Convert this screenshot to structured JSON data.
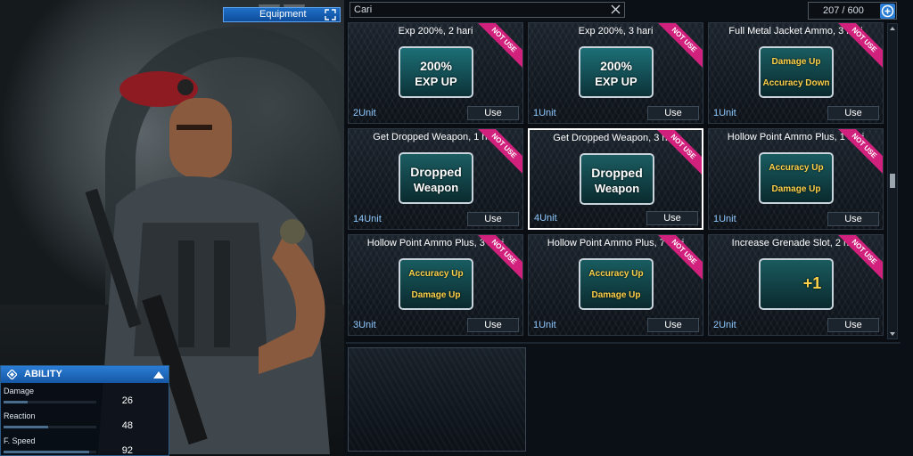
{
  "equipment": {
    "label": "Equipment"
  },
  "ability": {
    "title": "ABILITY",
    "stats": [
      {
        "label": "Damage",
        "value": "26",
        "fraction": 0.26
      },
      {
        "label": "Reaction",
        "value": "48",
        "fraction": 0.48
      },
      {
        "label": "F. Speed",
        "value": "92",
        "fraction": 0.92
      }
    ]
  },
  "search": {
    "placeholder": "Cari"
  },
  "inventory": {
    "count": "207 / 600"
  },
  "items": [
    {
      "title": "Exp 200%, 2 hari",
      "units": "2Unit",
      "use": "Use",
      "badge": "NOT USE",
      "line1": "200%",
      "line2": "EXP UP",
      "kind": "exp"
    },
    {
      "title": "Exp 200%, 3 hari",
      "units": "1Unit",
      "use": "Use",
      "badge": "NOT USE",
      "line1": "200%",
      "line2": "EXP UP",
      "kind": "exp"
    },
    {
      "title": "Full Metal Jacket Ammo, 3 hari",
      "units": "1Unit",
      "use": "Use",
      "badge": "NOT USE",
      "line1": "Damage Up",
      "line2": "Accuracy Down",
      "kind": "ammo"
    },
    {
      "title": "Get Dropped Weapon, 1 hari",
      "units": "14Unit",
      "use": "Use",
      "badge": "NOT USE",
      "line1": "Dropped",
      "line2": "Weapon",
      "kind": "weapon"
    },
    {
      "title": "Get Dropped Weapon, 3 hari",
      "units": "4Unit",
      "use": "Use",
      "badge": "NOT USE",
      "line1": "Dropped",
      "line2": "Weapon",
      "kind": "weapon"
    },
    {
      "title": "Hollow Point Ammo Plus, 1 hari",
      "units": "1Unit",
      "use": "Use",
      "badge": "NOT USE",
      "line1": "Accuracy Up",
      "line2": "Damage Up",
      "kind": "ammo"
    },
    {
      "title": "Hollow Point Ammo Plus, 3 hari",
      "units": "3Unit",
      "use": "Use",
      "badge": "NOT USE",
      "line1": "Accuracy Up",
      "line2": "Damage Up",
      "kind": "ammo"
    },
    {
      "title": "Hollow Point Ammo Plus, 7 hari",
      "units": "1Unit",
      "use": "Use",
      "badge": "NOT USE",
      "line1": "Accuracy Up",
      "line2": "Damage Up",
      "kind": "ammo"
    },
    {
      "title": "Increase Grenade Slot, 2 hari",
      "units": "2Unit",
      "use": "Use",
      "badge": "NOT USE",
      "line1": "",
      "line2": "+1",
      "kind": "grenade"
    }
  ]
}
